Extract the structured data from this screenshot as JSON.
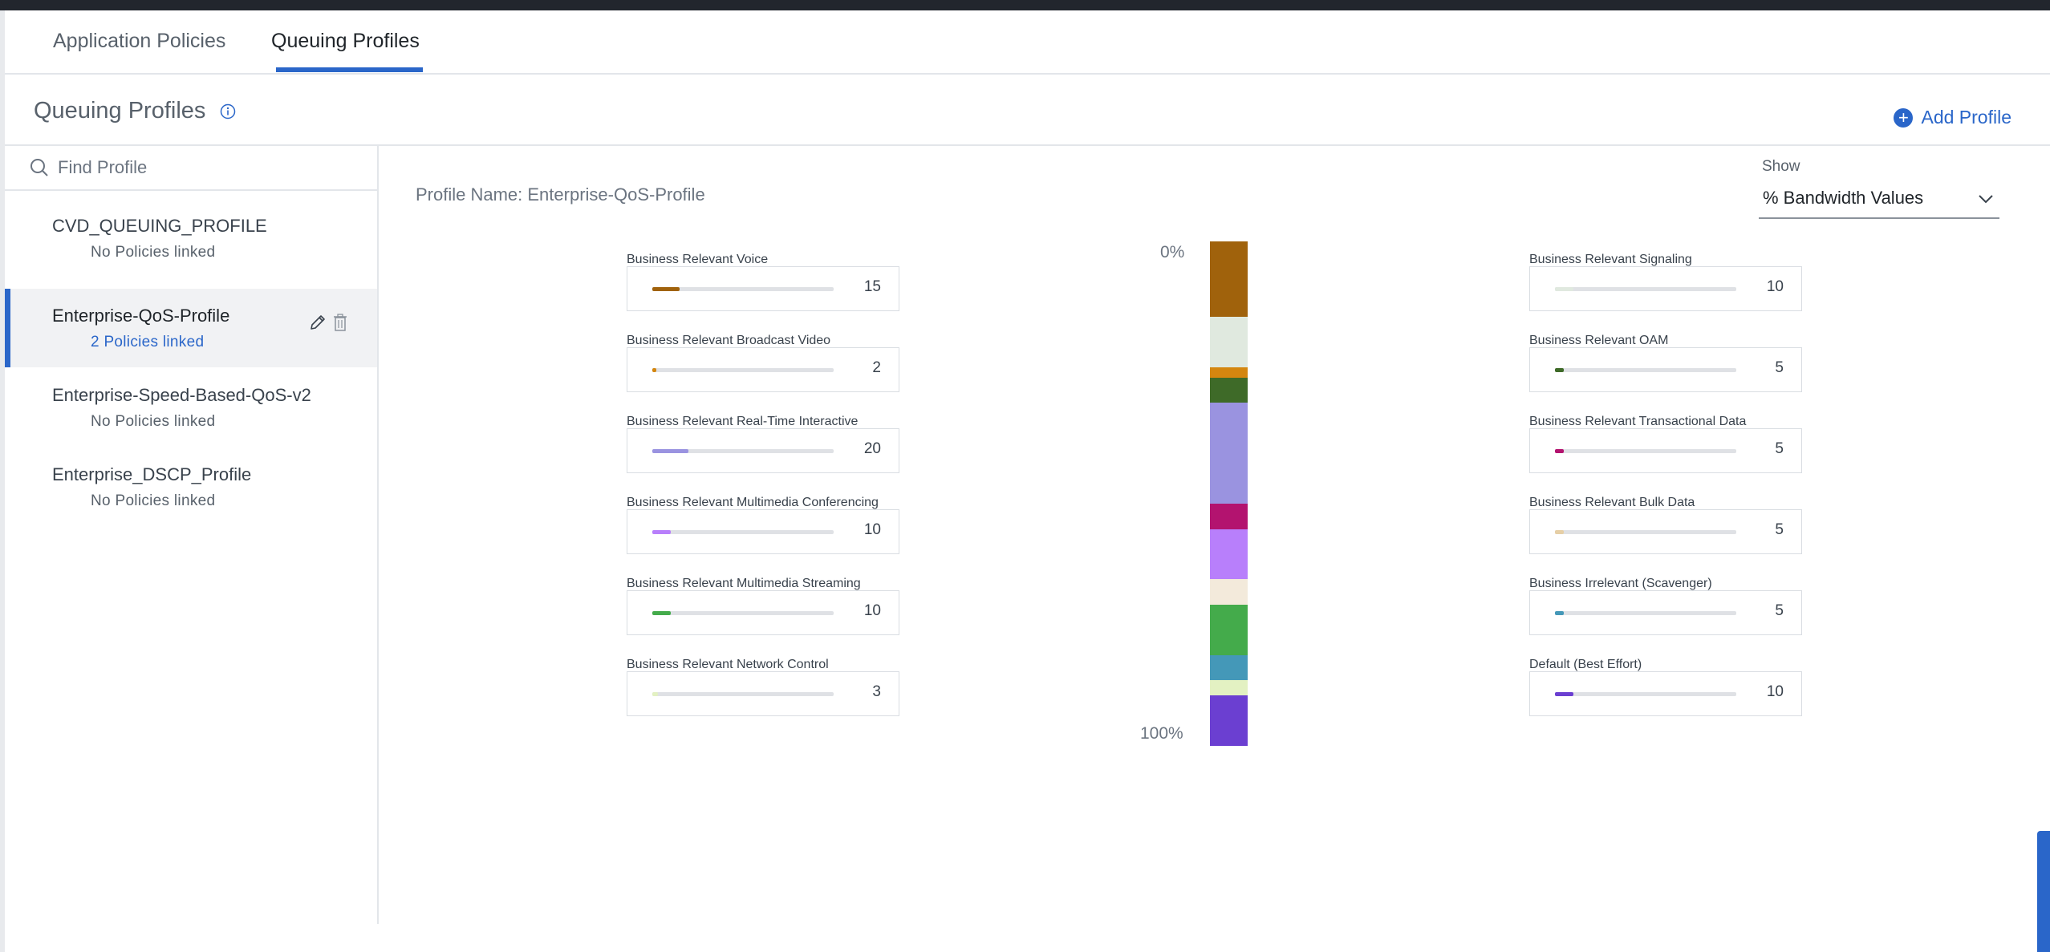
{
  "tabs": [
    {
      "label": "Application Policies",
      "active": false
    },
    {
      "label": "Queuing Profiles",
      "active": true
    }
  ],
  "header": {
    "title": "Queuing Profiles",
    "add_profile_label": "Add Profile"
  },
  "search": {
    "placeholder": "Find Profile",
    "value": ""
  },
  "profiles": [
    {
      "name": "CVD_QUEUING_PROFILE",
      "status": "No Policies linked",
      "selected": false
    },
    {
      "name": "Enterprise-QoS-Profile",
      "status": "2 Policies linked",
      "selected": true
    },
    {
      "name": "Enterprise-Speed-Based-QoS-v2",
      "status": "No Policies linked",
      "selected": false
    },
    {
      "name": "Enterprise_DSCP_Profile",
      "status": "No Policies linked",
      "selected": false
    }
  ],
  "main": {
    "profile_name_label": "Profile Name: Enterprise-QoS-Profile",
    "show_label": "Show",
    "show_value": "% Bandwidth Values"
  },
  "traffic_classes": {
    "left": [
      {
        "label": "Business Relevant Voice",
        "value": "15",
        "color": "#a0620c"
      },
      {
        "label": "Business Relevant Broadcast Video",
        "value": "2",
        "color": "#d4860f"
      },
      {
        "label": "Business Relevant Real-Time Interactive",
        "value": "20",
        "color": "#9a93e0"
      },
      {
        "label": "Business Relevant Multimedia Conferencing",
        "value": "10",
        "color": "#b87ffb"
      },
      {
        "label": "Business Relevant Multimedia Streaming",
        "value": "10",
        "color": "#44ab4b"
      },
      {
        "label": "Business Relevant Network Control",
        "value": "3",
        "color": "#e3f1c2"
      }
    ],
    "right": [
      {
        "label": "Business Relevant Signaling",
        "value": "10",
        "color": "#e0e9df"
      },
      {
        "label": "Business Relevant OAM",
        "value": "5",
        "color": "#3e6a28"
      },
      {
        "label": "Business Relevant Transactional Data",
        "value": "5",
        "color": "#b3136f"
      },
      {
        "label": "Business Relevant Bulk Data",
        "value": "5",
        "color": "#e6cfa6"
      },
      {
        "label": "Business Irrelevant (Scavenger)",
        "value": "5",
        "color": "#4498b8"
      },
      {
        "label": "Default (Best Effort)",
        "value": "10",
        "color": "#6b3fd1"
      }
    ]
  },
  "bandwidth_stack": {
    "top_label": "0%",
    "bottom_label": "100%",
    "segments": [
      {
        "name": "Business Relevant Voice",
        "value": 15,
        "color": "#a0620c"
      },
      {
        "name": "Business Relevant Signaling",
        "value": 10,
        "color": "#e0e9df"
      },
      {
        "name": "Business Relevant Broadcast Video",
        "value": 2,
        "color": "#d4860f"
      },
      {
        "name": "Business Relevant OAM",
        "value": 5,
        "color": "#3e6a28"
      },
      {
        "name": "Business Relevant Real-Time Interactive",
        "value": 20,
        "color": "#9a93e0"
      },
      {
        "name": "Business Relevant Transactional Data",
        "value": 5,
        "color": "#b3136f"
      },
      {
        "name": "Business Relevant Multimedia Conferencing",
        "value": 10,
        "color": "#b87ffb"
      },
      {
        "name": "Business Relevant Bulk Data",
        "value": 5,
        "color": "#f3eadb"
      },
      {
        "name": "Business Relevant Multimedia Streaming",
        "value": 10,
        "color": "#44ab4b"
      },
      {
        "name": "Business Irrelevant (Scavenger)",
        "value": 5,
        "color": "#4498b8"
      },
      {
        "name": "Business Relevant Network Control",
        "value": 3,
        "color": "#e3f1c2"
      },
      {
        "name": "Default (Best Effort)",
        "value": 10,
        "color": "#6b3fd1"
      }
    ]
  },
  "colors": {
    "accent": "#2a66c9",
    "topbar": "#22262d"
  }
}
